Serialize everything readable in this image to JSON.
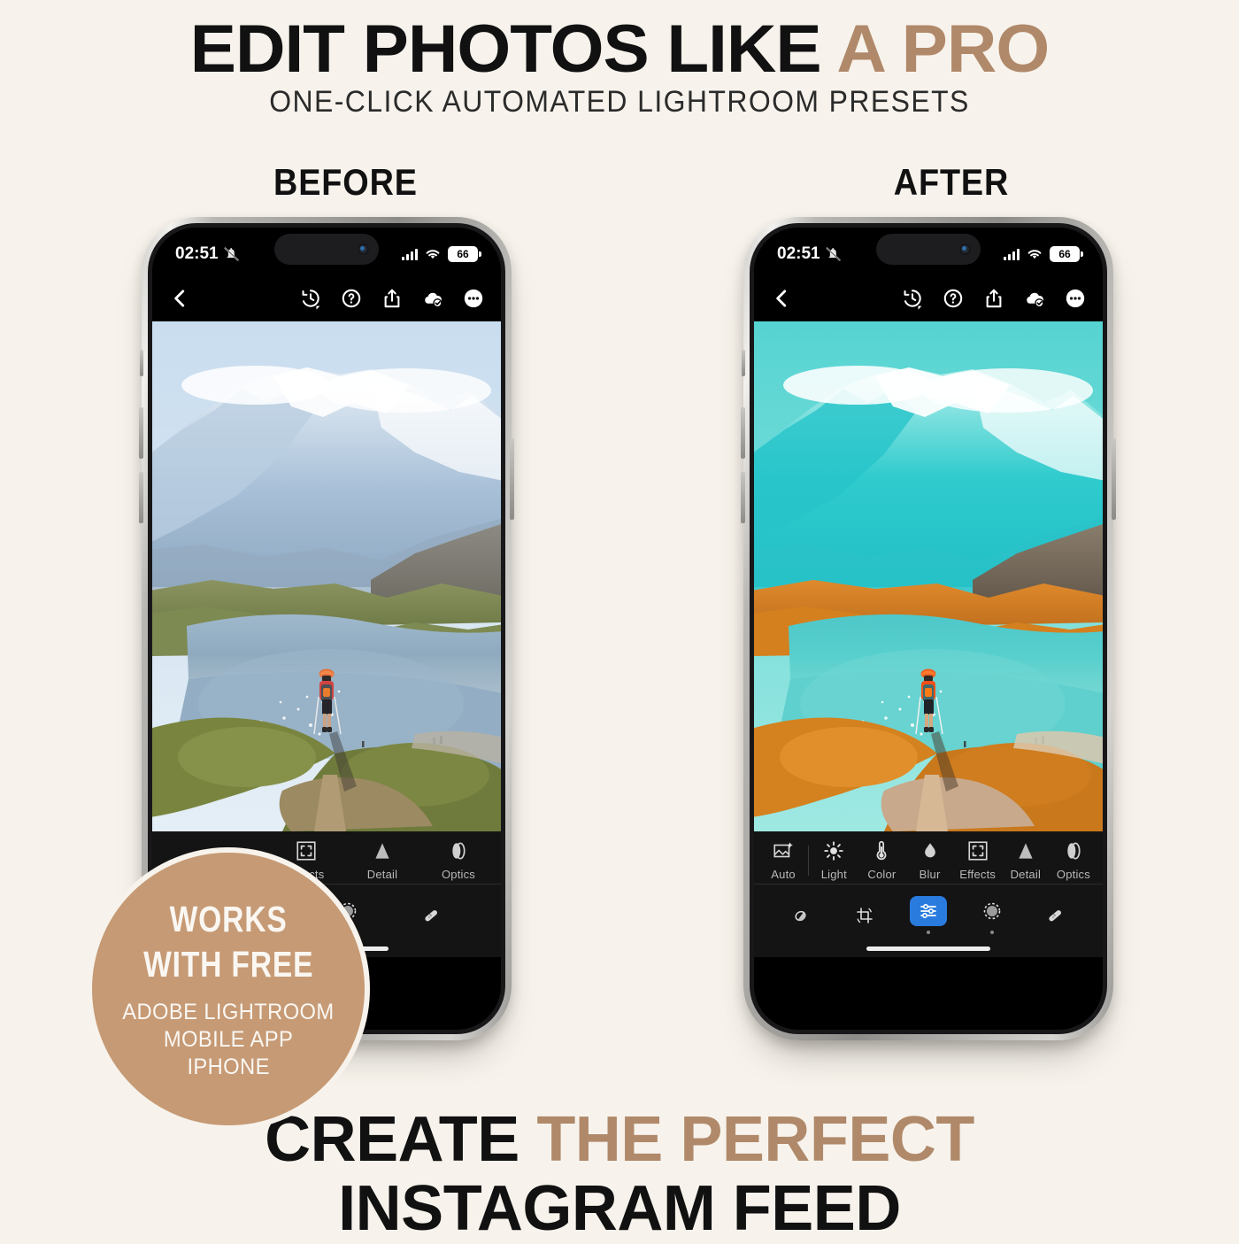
{
  "page": {
    "background_color": "#f7f3ec",
    "accent_color": "#b0896a",
    "badge_color": "#c69a75"
  },
  "header": {
    "title_plain": "EDIT PHOTOS LIKE ",
    "title_accent": "A PRO",
    "subtitle": "ONE-CLICK AUTOMATED LIGHTROOM PRESETS"
  },
  "comparison": {
    "before_label": "BEFORE",
    "after_label": "AFTER"
  },
  "status_bar": {
    "time": "02:51",
    "mute_icon": "bell-slash-icon",
    "signal_icon": "cellular-bars-icon",
    "wifi_icon": "wifi-icon",
    "battery_level": "66"
  },
  "app_bar": {
    "back_icon": "chevron-left-icon",
    "history_icon": "history-clock-icon",
    "help_icon": "question-circle-icon",
    "share_icon": "share-upload-icon",
    "cloud_icon": "cloud-check-icon",
    "more_icon": "more-ellipsis-icon"
  },
  "editor": {
    "before_tools": [
      {
        "label": "Effects",
        "icon": "effects-frame-icon",
        "has_dot": true
      },
      {
        "label": "Detail",
        "icon": "detail-triangle-icon",
        "has_dot": false
      },
      {
        "label": "Optics",
        "icon": "optics-lens-icon",
        "has_dot": false
      }
    ],
    "after_tools": [
      {
        "label": "Auto",
        "icon": "auto-magic-image-icon",
        "has_dot": false
      },
      {
        "label": "Light",
        "icon": "light-sun-icon",
        "has_dot": true
      },
      {
        "label": "Color",
        "icon": "color-thermometer-icon",
        "has_dot": true
      },
      {
        "label": "Blur",
        "icon": "blur-droplet-icon",
        "has_dot": false
      },
      {
        "label": "Effects",
        "icon": "effects-frame-icon",
        "has_dot": true
      },
      {
        "label": "Detail",
        "icon": "detail-triangle-icon",
        "has_dot": false
      },
      {
        "label": "Optics",
        "icon": "optics-lens-icon",
        "has_dot": false
      }
    ],
    "before_bottom_nav": [
      {
        "icon": "masking-circle-icon",
        "active": false,
        "has_dot": true
      },
      {
        "icon": "healing-brush-icon",
        "active": false,
        "has_dot": false
      }
    ],
    "after_bottom_nav": [
      {
        "icon": "presets-contrast-icon",
        "active": false,
        "has_dot": false
      },
      {
        "icon": "crop-rotate-icon",
        "active": false,
        "has_dot": false
      },
      {
        "icon": "edit-sliders-icon",
        "active": true,
        "has_dot": true
      },
      {
        "icon": "masking-circle-icon",
        "active": false,
        "has_dot": true
      },
      {
        "icon": "healing-brush-icon",
        "active": false,
        "has_dot": false
      }
    ]
  },
  "badge": {
    "line1": "WORKS",
    "line2": "WITH FREE",
    "line3": "ADOBE LIGHTROOM",
    "line4": "MOBILE APP",
    "line5": "IPHONE"
  },
  "footer": {
    "line1_plain": "CREATE ",
    "line1_accent": "THE PERFECT",
    "line2": "INSTAGRAM FEED"
  }
}
